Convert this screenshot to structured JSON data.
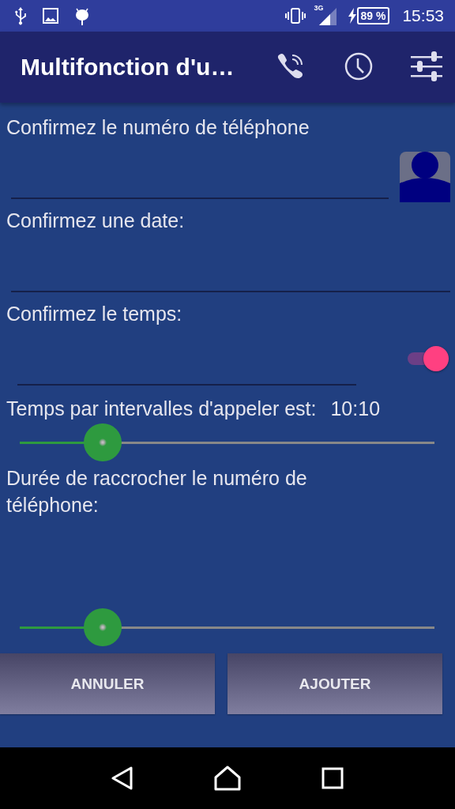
{
  "status_bar": {
    "network": "3G",
    "battery": "89 %",
    "time": "15:53"
  },
  "app_bar": {
    "title": "Multifonction d'u…"
  },
  "fields": [
    {
      "kind": "contact",
      "label": "Confirmez le numéro de téléphone"
    },
    {
      "kind": "plain",
      "label": "Confirmez une date:"
    },
    {
      "kind": "switch",
      "label": "Confirmez le temps:",
      "on": true
    }
  ],
  "sliders": [
    {
      "label": "Temps par intervalles d'appeler est:",
      "reading": "10:10",
      "level": 0.2
    },
    {
      "label": "Durée de raccrocher le numéro de téléphone:",
      "level": 0.2
    }
  ],
  "buttons": [
    "ANNULER",
    "AJOUTER"
  ]
}
